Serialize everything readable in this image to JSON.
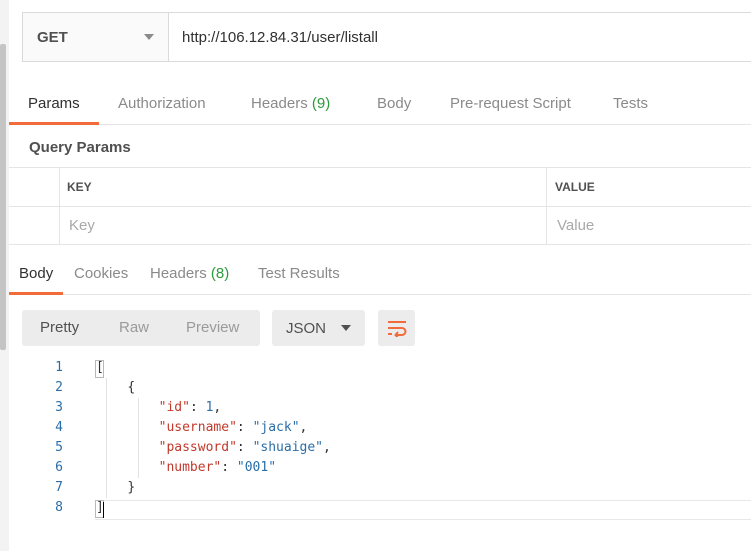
{
  "request": {
    "method": "GET",
    "url": "http://106.12.84.31/user/listall"
  },
  "request_tabs": [
    {
      "label": "Params",
      "count": ""
    },
    {
      "label": "Authorization",
      "count": ""
    },
    {
      "label": "Headers",
      "count": "(9)"
    },
    {
      "label": "Body",
      "count": ""
    },
    {
      "label": "Pre-request Script",
      "count": ""
    },
    {
      "label": "Tests",
      "count": ""
    }
  ],
  "query_params": {
    "title": "Query Params",
    "columns": [
      "KEY",
      "VALUE"
    ],
    "key_placeholder": "Key",
    "value_placeholder": "Value"
  },
  "response_tabs": [
    {
      "label": "Body",
      "count": ""
    },
    {
      "label": "Cookies",
      "count": ""
    },
    {
      "label": "Headers",
      "count": "(8)"
    },
    {
      "label": "Test Results",
      "count": ""
    }
  ],
  "response_toolbar": {
    "views": [
      "Pretty",
      "Raw",
      "Preview"
    ],
    "format": "JSON"
  },
  "code": {
    "line_numbers": [
      "1",
      "2",
      "3",
      "4",
      "5",
      "6",
      "7",
      "8"
    ],
    "lines": [
      {
        "indent": "",
        "parts": [
          {
            "t": "p",
            "v": "["
          }
        ]
      },
      {
        "indent": "    ",
        "parts": [
          {
            "t": "p",
            "v": "{"
          }
        ]
      },
      {
        "indent": "        ",
        "parts": [
          {
            "t": "k",
            "v": "\"id\""
          },
          {
            "t": "p",
            "v": ": "
          },
          {
            "t": "n",
            "v": "1"
          },
          {
            "t": "p",
            "v": ","
          }
        ]
      },
      {
        "indent": "        ",
        "parts": [
          {
            "t": "k",
            "v": "\"username\""
          },
          {
            "t": "p",
            "v": ": "
          },
          {
            "t": "s",
            "v": "\"jack\""
          },
          {
            "t": "p",
            "v": ","
          }
        ]
      },
      {
        "indent": "        ",
        "parts": [
          {
            "t": "k",
            "v": "\"password\""
          },
          {
            "t": "p",
            "v": ": "
          },
          {
            "t": "s",
            "v": "\"shuaige\""
          },
          {
            "t": "p",
            "v": ","
          }
        ]
      },
      {
        "indent": "        ",
        "parts": [
          {
            "t": "k",
            "v": "\"number\""
          },
          {
            "t": "p",
            "v": ": "
          },
          {
            "t": "s",
            "v": "\"001\""
          }
        ]
      },
      {
        "indent": "    ",
        "parts": [
          {
            "t": "p",
            "v": "}"
          }
        ]
      },
      {
        "indent": "",
        "parts": [
          {
            "t": "p",
            "v": "]"
          }
        ]
      }
    ]
  },
  "colors": {
    "accent": "#f26b3a",
    "count_green": "#2d9a3b",
    "json_key": "#c0392b",
    "json_value": "#2a6ea8"
  },
  "icons": {
    "method_dropdown": "chevron-down-icon",
    "format_dropdown": "chevron-down-icon",
    "wrap": "wrap-lines-icon"
  }
}
